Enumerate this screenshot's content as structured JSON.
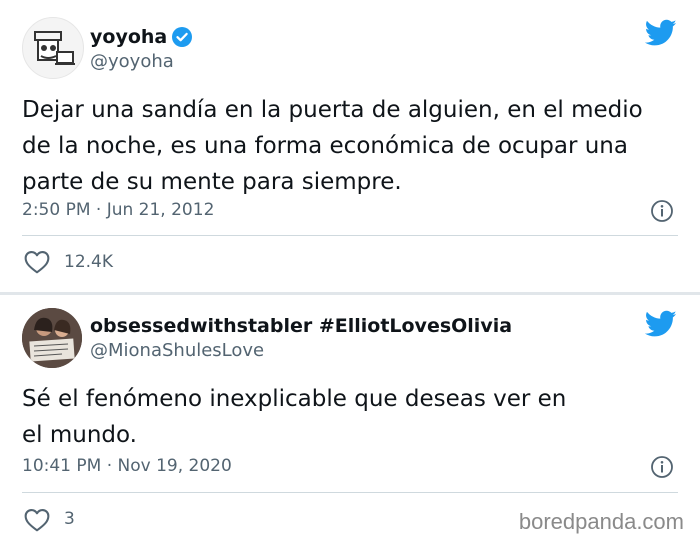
{
  "tweets": [
    {
      "display_name": "yoyoha",
      "handle": "@yoyoha",
      "verified": true,
      "text_lines": [
        "Dejar una sandía en la puerta de alguien, en el medio",
        "de la noche, es una forma económica de ocupar una",
        "parte de su mente para siempre."
      ],
      "timestamp": "2:50 PM · Jun 21, 2012",
      "likes": "12.4K"
    },
    {
      "display_name": "obsessedwithstabler #ElliotLovesOlivia",
      "handle": "@MionaShulesLove",
      "verified": false,
      "text_lines": [
        "Sé el fenómeno inexplicable que deseas ver en",
        "el mundo."
      ],
      "timestamp": "10:41 PM · Nov 19, 2020",
      "likes": "3"
    }
  ],
  "watermark": "boredpanda.com",
  "colors": {
    "twitter_blue": "#1d9bf0",
    "secondary_text": "#536471",
    "primary_text": "#0f1419",
    "divider": "#cfd9de"
  },
  "icons": [
    "twitter-bird-icon",
    "verified-badge-icon",
    "info-icon",
    "heart-icon"
  ]
}
